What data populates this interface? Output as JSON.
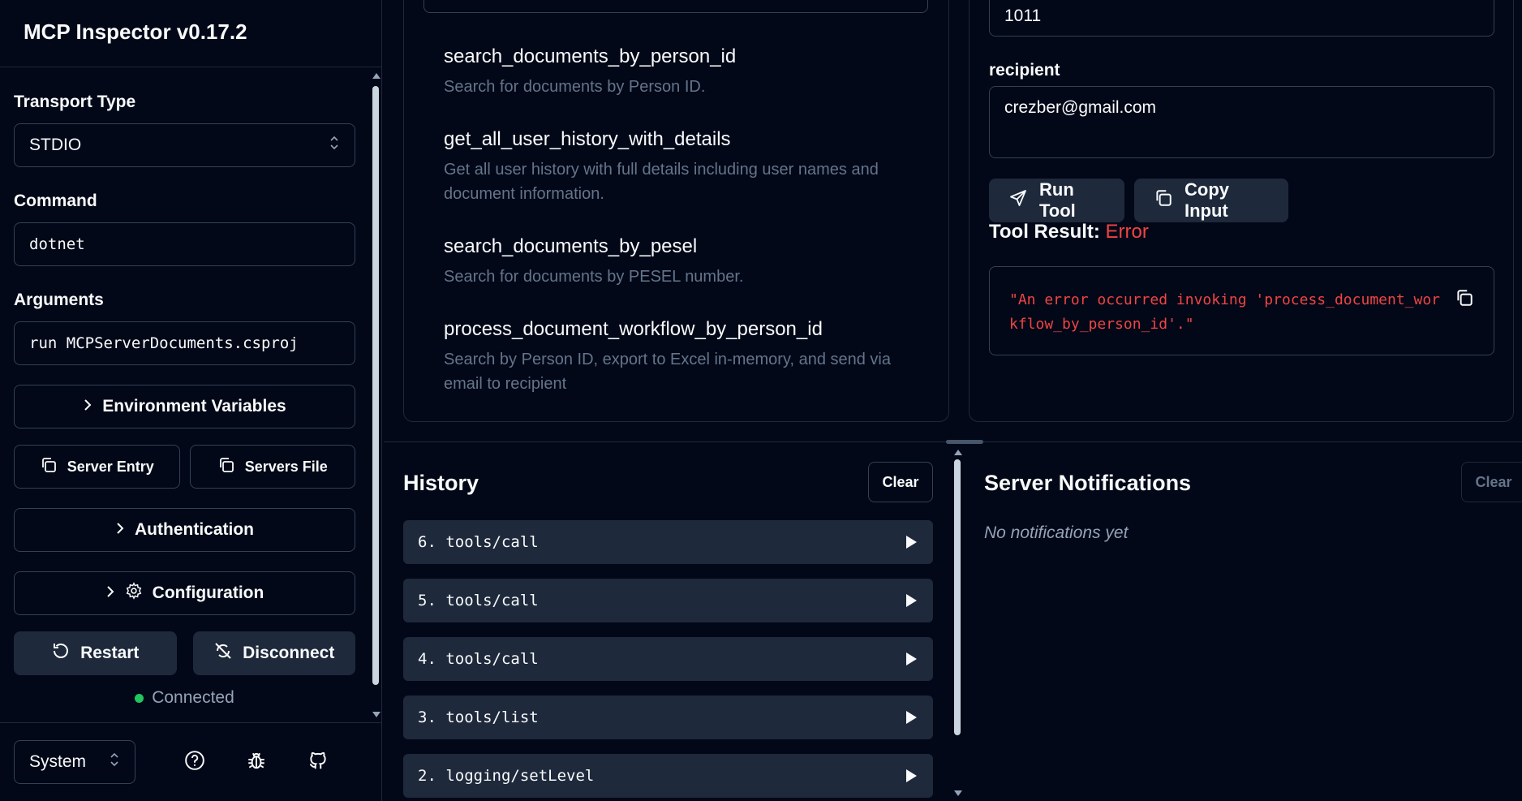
{
  "app": {
    "title": "MCP Inspector v0.17.2"
  },
  "sidebar": {
    "transport_label": "Transport Type",
    "transport_value": "STDIO",
    "command_label": "Command",
    "command_value": "dotnet",
    "arguments_label": "Arguments",
    "arguments_value": "run MCPServerDocuments.csproj",
    "env_vars_label": "Environment Variables",
    "server_entry_label": "Server Entry",
    "servers_file_label": "Servers File",
    "auth_label": "Authentication",
    "config_label": "Configuration",
    "restart_label": "Restart",
    "disconnect_label": "Disconnect",
    "status_text": "Connected",
    "theme_value": "System"
  },
  "tools": [
    {
      "name": "search_documents_by_person_id",
      "description": "Search for documents by Person ID."
    },
    {
      "name": "get_all_user_history_with_details",
      "description": "Get all user history with full details including user names and document information."
    },
    {
      "name": "search_documents_by_pesel",
      "description": "Search for documents by PESEL number."
    },
    {
      "name": "process_document_workflow_by_person_id",
      "description": "Search by Person ID, export to Excel in-memory, and send via email to recipient"
    }
  ],
  "detail": {
    "person_id_value": "1011",
    "recipient_label": "recipient",
    "recipient_value": "crezber@gmail.com",
    "run_tool_label": "Run Tool",
    "copy_input_label": "Copy Input",
    "result_label": "Tool Result:",
    "result_status": "Error",
    "result_text": "\"An error occurred invoking 'process_document_workflow_by_person_id'.\""
  },
  "history": {
    "title": "History",
    "clear_label": "Clear",
    "items": [
      "6. tools/call",
      "5. tools/call",
      "4. tools/call",
      "3. tools/list",
      "2. logging/setLevel"
    ]
  },
  "notifications": {
    "title": "Server Notifications",
    "clear_label": "Clear",
    "empty_text": "No notifications yet"
  },
  "colors": {
    "background": "#020817",
    "border": "#1e293b",
    "error": "#ef4444",
    "connected": "#22c55e",
    "muted": "#64748b"
  }
}
